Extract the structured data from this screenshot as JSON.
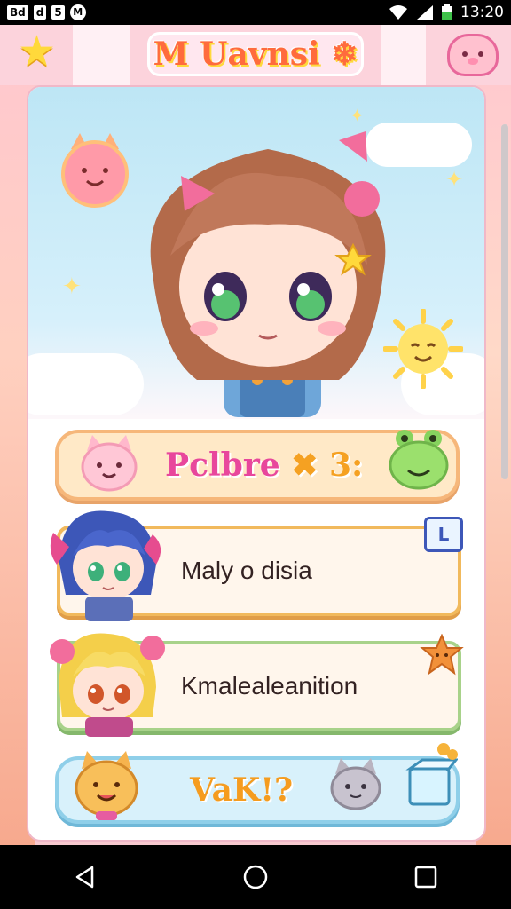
{
  "status_bar": {
    "left_icons": [
      "Bd",
      "d",
      "5",
      "M"
    ],
    "time": "13:20"
  },
  "header": {
    "title": "M Uavnsi ❄",
    "left_icon": "star-icon",
    "right_icon": "cat-face-icon"
  },
  "hero": {
    "avatar": "chibi-girl-brown-hair",
    "stickers": [
      "fox-sticker",
      "sun-sticker",
      "sparkle-star-icon"
    ]
  },
  "menu": {
    "profile_button": {
      "label_main": "Pclbre",
      "label_accent": "✖ 3:",
      "left_icon": "pink-cat-icon",
      "right_icon": "green-frog-icon"
    },
    "rows": [
      {
        "label": "Maly o disia",
        "avatar": "blue-hair-girl-avatar",
        "badge": "L"
      },
      {
        "label": "Kmalealeanition",
        "avatar": "blonde-girl-avatar",
        "badge": "orange-star-icon"
      }
    ],
    "bottom_button": {
      "label": "VaK!?",
      "left_icon": "orange-cat-icon",
      "mid_icon": "grey-cat-icon",
      "right_icon": "box-icon"
    }
  },
  "colors": {
    "accent_pink": "#e8479c",
    "accent_orange": "#f59c1f",
    "header_bg": "#fcd3dc"
  },
  "nav_bar": {
    "back": "back-icon",
    "home": "home-icon",
    "recents": "recents-icon"
  }
}
